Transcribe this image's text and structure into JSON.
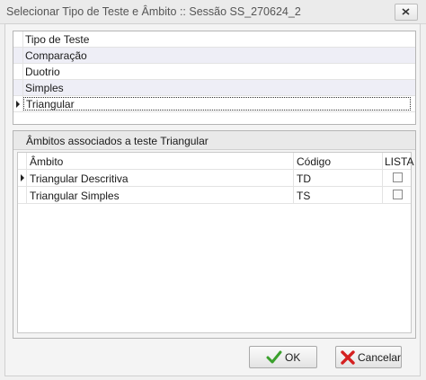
{
  "window": {
    "title": "Selecionar Tipo de Teste e Âmbito :: Sessão SS_270624_2"
  },
  "test_types": {
    "header": "Tipo de Teste",
    "items": [
      "Comparação",
      "Duotrio",
      "Simples",
      "Triangular"
    ],
    "selected": "Triangular"
  },
  "scopes": {
    "caption": "Âmbitos associados a teste Triangular",
    "columns": {
      "ambito": "Âmbito",
      "codigo": "Código",
      "lista": "LISTA"
    },
    "rows": [
      {
        "ambito": "Triangular Descritiva",
        "codigo": "TD",
        "lista": false
      },
      {
        "ambito": "Triangular Simples",
        "codigo": "TS",
        "lista": false
      }
    ]
  },
  "buttons": {
    "ok": "OK",
    "cancel": "Cancelar"
  },
  "colors": {
    "ok_icon": "#3aa02c",
    "cancel_icon": "#d42020"
  }
}
